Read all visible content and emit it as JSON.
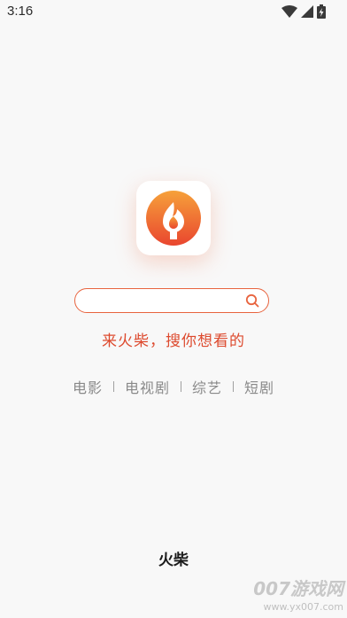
{
  "status_bar": {
    "time": "3:16",
    "icons": [
      "wifi-icon",
      "signal-icon",
      "battery-charging-icon"
    ]
  },
  "logo": {
    "icon": "flame-icon",
    "colors": {
      "gradient_top": "#f6a13a",
      "gradient_bottom": "#e9462f",
      "inner": "#ffffff"
    }
  },
  "search": {
    "value": "",
    "placeholder": "",
    "icon": "search-icon",
    "accent_color": "#e8643f"
  },
  "slogan": "来火柴，搜你想看的",
  "categories": [
    {
      "label": "电影"
    },
    {
      "label": "电视剧"
    },
    {
      "label": "综艺"
    },
    {
      "label": "短剧"
    }
  ],
  "brand": "火柴",
  "watermark": {
    "title": "007游戏网",
    "url": "www.yx007.com"
  }
}
